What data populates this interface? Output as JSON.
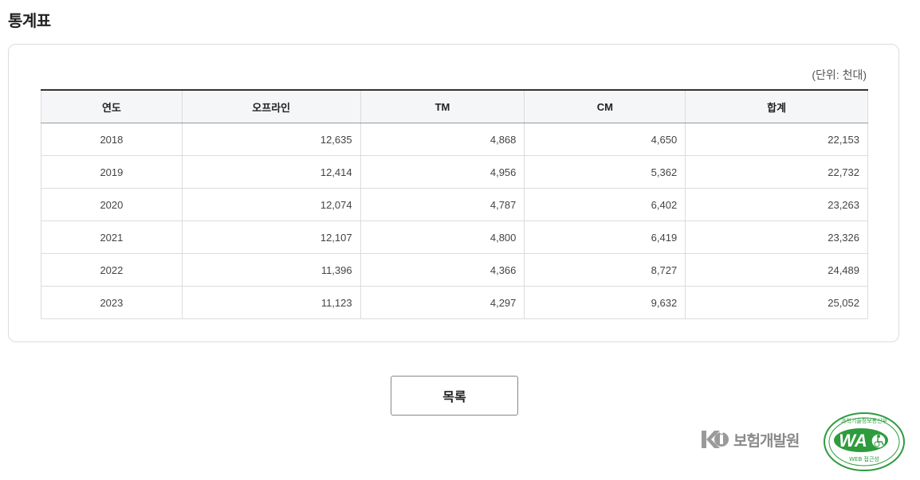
{
  "page": {
    "title": "통계표"
  },
  "unit_note": "(단위: 천대)",
  "table": {
    "columns": [
      "연도",
      "오프라인",
      "TM",
      "CM",
      "합계"
    ],
    "rows": [
      [
        "2018",
        "12,635",
        "4,868",
        "4,650",
        "22,153"
      ],
      [
        "2019",
        "12,414",
        "4,956",
        "5,362",
        "22,732"
      ],
      [
        "2020",
        "12,074",
        "4,787",
        "6,402",
        "23,263"
      ],
      [
        "2021",
        "12,107",
        "4,800",
        "6,419",
        "23,326"
      ],
      [
        "2022",
        "11,396",
        "4,366",
        "8,727",
        "24,489"
      ],
      [
        "2023",
        "11,123",
        "4,297",
        "9,632",
        "25,052"
      ]
    ]
  },
  "list_button": {
    "label": "목록"
  },
  "footer": {
    "kidi_logo_text": "보험개발원",
    "wa_mark": {
      "top_text": "과학기술정보통신부",
      "main_text": "WA",
      "sub_text": "WEB 접근성",
      "icon": "wheelchair-icon",
      "color": "#2e9b3e"
    }
  },
  "colors": {
    "header_bg": "#f5f6f8",
    "border": "#dcdcdc",
    "logo_gray": "#8a8a8a"
  }
}
